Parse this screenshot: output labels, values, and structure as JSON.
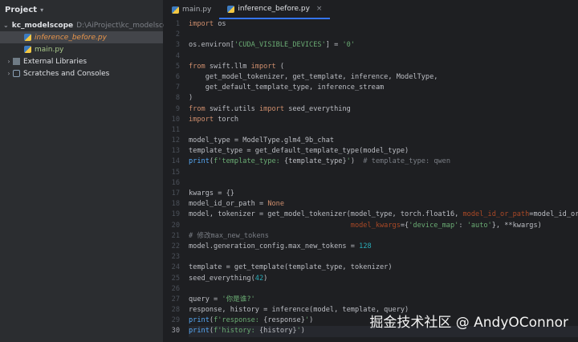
{
  "sidebar": {
    "title": "Project",
    "root_name": "kc_modelscope",
    "root_path": "D:\\AiProject\\kc_modelscope",
    "items": [
      {
        "label": "inference_before.py"
      },
      {
        "label": "main.py"
      },
      {
        "label": "External Libraries"
      },
      {
        "label": "Scratches and Consoles"
      }
    ]
  },
  "tabs": [
    {
      "label": "main.py"
    },
    {
      "label": "inference_before.py",
      "close": "×"
    }
  ],
  "lines": [
    {
      "n": "1",
      "t": [
        {
          "c": "kw",
          "s": "import"
        },
        {
          "c": "",
          "s": " os"
        }
      ]
    },
    {
      "n": "2",
      "t": []
    },
    {
      "n": "3",
      "t": [
        {
          "c": "",
          "s": "os.environ["
        },
        {
          "c": "str",
          "s": "'CUDA_VISIBLE_DEVICES'"
        },
        {
          "c": "",
          "s": "] = "
        },
        {
          "c": "str",
          "s": "'0'"
        }
      ]
    },
    {
      "n": "4",
      "t": []
    },
    {
      "n": "5",
      "t": [
        {
          "c": "kw",
          "s": "from"
        },
        {
          "c": "",
          "s": " swift.llm "
        },
        {
          "c": "kw",
          "s": "import"
        },
        {
          "c": "",
          "s": " ("
        }
      ]
    },
    {
      "n": "6",
      "t": [
        {
          "c": "",
          "s": "    get_model_tokenizer, get_template, inference, ModelType,"
        }
      ]
    },
    {
      "n": "7",
      "t": [
        {
          "c": "",
          "s": "    get_default_template_type, inference_stream"
        }
      ]
    },
    {
      "n": "8",
      "t": [
        {
          "c": "",
          "s": ")"
        }
      ]
    },
    {
      "n": "9",
      "t": [
        {
          "c": "kw",
          "s": "from"
        },
        {
          "c": "",
          "s": " swift.utils "
        },
        {
          "c": "kw",
          "s": "import"
        },
        {
          "c": "",
          "s": " seed_everything"
        }
      ]
    },
    {
      "n": "10",
      "t": [
        {
          "c": "kw",
          "s": "import"
        },
        {
          "c": "",
          "s": " torch"
        }
      ]
    },
    {
      "n": "11",
      "t": []
    },
    {
      "n": "12",
      "t": [
        {
          "c": "",
          "s": "model_type = ModelType.glm4_9b_chat"
        }
      ]
    },
    {
      "n": "13",
      "t": [
        {
          "c": "",
          "s": "template_type = get_default_template_type(model_type)"
        }
      ]
    },
    {
      "n": "14",
      "t": [
        {
          "c": "fn",
          "s": "print"
        },
        {
          "c": "",
          "s": "("
        },
        {
          "c": "str",
          "s": "f'template_type: "
        },
        {
          "c": "",
          "s": "{template_type}"
        },
        {
          "c": "str",
          "s": "'"
        },
        {
          "c": "",
          "s": ")  "
        },
        {
          "c": "cm",
          "s": "# template_type: qwen"
        }
      ]
    },
    {
      "n": "15",
      "t": []
    },
    {
      "n": "16",
      "t": []
    },
    {
      "n": "17",
      "t": [
        {
          "c": "",
          "s": "kwargs = {}"
        }
      ]
    },
    {
      "n": "18",
      "t": [
        {
          "c": "",
          "s": "model_id_or_path = "
        },
        {
          "c": "kw",
          "s": "None"
        }
      ]
    },
    {
      "n": "19",
      "t": [
        {
          "c": "",
          "s": "model, tokenizer = get_model_tokenizer(model_type, torch.float16, "
        },
        {
          "c": "param",
          "s": "model_id_or_path"
        },
        {
          "c": "",
          "s": "=model_id_or_path,"
        }
      ]
    },
    {
      "n": "20",
      "t": [
        {
          "c": "",
          "s": "                                       "
        },
        {
          "c": "param",
          "s": "model_kwargs"
        },
        {
          "c": "",
          "s": "={"
        },
        {
          "c": "str",
          "s": "'device_map'"
        },
        {
          "c": "",
          "s": ": "
        },
        {
          "c": "str",
          "s": "'auto'"
        },
        {
          "c": "",
          "s": "}, **kwargs)"
        }
      ]
    },
    {
      "n": "21",
      "t": [
        {
          "c": "cm",
          "s": "# 修改max_new_tokens"
        }
      ]
    },
    {
      "n": "22",
      "t": [
        {
          "c": "",
          "s": "model.generation_config.max_new_tokens = "
        },
        {
          "c": "num",
          "s": "128"
        }
      ]
    },
    {
      "n": "23",
      "t": []
    },
    {
      "n": "24",
      "t": [
        {
          "c": "",
          "s": "template = get_template(template_type, tokenizer)"
        }
      ]
    },
    {
      "n": "25",
      "t": [
        {
          "c": "",
          "s": "seed_everything("
        },
        {
          "c": "num",
          "s": "42"
        },
        {
          "c": "",
          "s": ")"
        }
      ]
    },
    {
      "n": "26",
      "t": []
    },
    {
      "n": "27",
      "t": [
        {
          "c": "",
          "s": "query = "
        },
        {
          "c": "str",
          "s": "'你是谁?'"
        }
      ]
    },
    {
      "n": "28",
      "t": [
        {
          "c": "",
          "s": "response, history = inference(model, template, query)"
        }
      ]
    },
    {
      "n": "29",
      "t": [
        {
          "c": "fn",
          "s": "print"
        },
        {
          "c": "",
          "s": "("
        },
        {
          "c": "str",
          "s": "f'response: "
        },
        {
          "c": "",
          "s": "{response}"
        },
        {
          "c": "str",
          "s": "'"
        },
        {
          "c": "",
          "s": ")"
        }
      ]
    },
    {
      "n": "30",
      "t": [
        {
          "c": "fn",
          "s": "print"
        },
        {
          "c": "",
          "s": "("
        },
        {
          "c": "str",
          "s": "f'history: "
        },
        {
          "c": "",
          "s": "{history}"
        },
        {
          "c": "str",
          "s": "'"
        },
        {
          "c": "",
          "s": ")"
        }
      ]
    }
  ],
  "watermark": "掘金技术社区 @ AndyOConnor"
}
